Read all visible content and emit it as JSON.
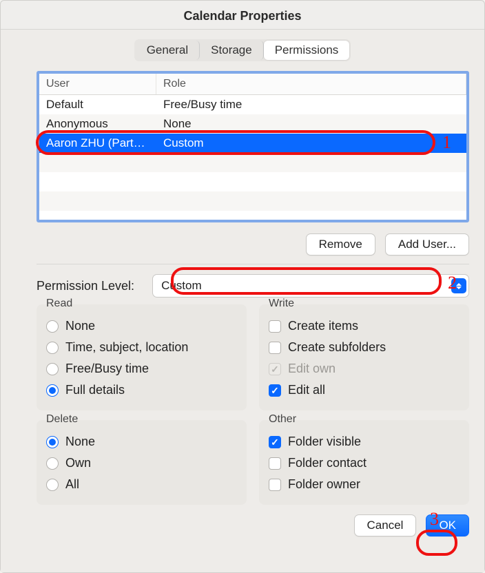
{
  "window": {
    "title": "Calendar Properties"
  },
  "tabs": {
    "general": "General",
    "storage": "Storage",
    "permissions": "Permissions",
    "active": "permissions"
  },
  "table": {
    "headers": {
      "user": "User",
      "role": "Role"
    },
    "rows": [
      {
        "user": "Default",
        "role": "Free/Busy time",
        "selected": false
      },
      {
        "user": "Anonymous",
        "role": "None",
        "selected": false
      },
      {
        "user": "Aaron ZHU (Part…",
        "role": "Custom",
        "selected": true
      }
    ]
  },
  "buttons": {
    "remove": "Remove",
    "add_user": "Add User...",
    "cancel": "Cancel",
    "ok": "OK"
  },
  "permission_level": {
    "label": "Permission Level:",
    "value": "Custom"
  },
  "groups": {
    "read": {
      "title": "Read",
      "options": [
        {
          "label": "None",
          "checked": false
        },
        {
          "label": "Time, subject, location",
          "checked": false
        },
        {
          "label": "Free/Busy time",
          "checked": false
        },
        {
          "label": "Full details",
          "checked": true
        }
      ]
    },
    "write": {
      "title": "Write",
      "options": [
        {
          "label": "Create items",
          "checked": false,
          "disabled": false
        },
        {
          "label": "Create subfolders",
          "checked": false,
          "disabled": false
        },
        {
          "label": "Edit own",
          "checked": true,
          "disabled": true
        },
        {
          "label": "Edit all",
          "checked": true,
          "disabled": false
        }
      ]
    },
    "delete": {
      "title": "Delete",
      "options": [
        {
          "label": "None",
          "checked": true
        },
        {
          "label": "Own",
          "checked": false
        },
        {
          "label": "All",
          "checked": false
        }
      ]
    },
    "other": {
      "title": "Other",
      "options": [
        {
          "label": "Folder visible",
          "checked": true
        },
        {
          "label": "Folder contact",
          "checked": false
        },
        {
          "label": "Folder owner",
          "checked": false
        }
      ]
    }
  },
  "annotations": {
    "one": "1",
    "two": "2",
    "three": "3"
  }
}
